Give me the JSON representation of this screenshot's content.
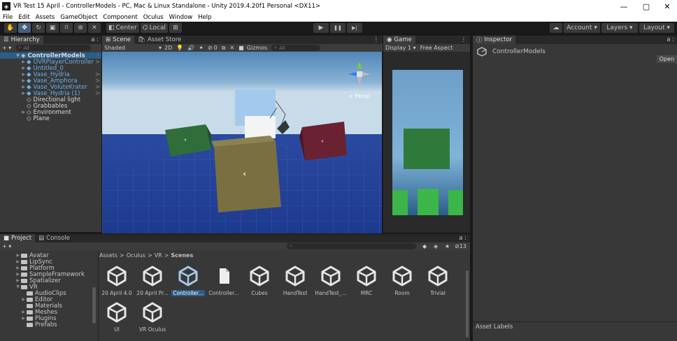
{
  "window": {
    "title": "VR Test 15 April - ControllerModels - PC, Mac & Linux Standalone - Unity 2019.4.20f1 Personal <DX11>",
    "logo": "◈",
    "minimize": "—",
    "maximize": "▢",
    "close": "✕"
  },
  "menu": [
    "File",
    "Edit",
    "Assets",
    "GameObject",
    "Component",
    "Oculus",
    "Window",
    "Help"
  ],
  "toolbar": {
    "tools": [
      "✋",
      "✥",
      "↻",
      "▣",
      "⌑",
      "⊛",
      "✕"
    ],
    "pivot": "Center",
    "space": "Local",
    "snap": "⊞",
    "play": "▶",
    "pause": "❚❚",
    "step": "▶|",
    "cloud": "☁",
    "account": "Account ▾",
    "layers": "Layers ▾",
    "layout": "Layout ▾"
  },
  "hierarchy": {
    "tab": "Hierarchy",
    "lock": "a :",
    "add": "+ ▾",
    "search_placeholder": "All",
    "items": [
      {
        "label": "ControllerModels",
        "kind": "scene",
        "sel": true,
        "more": "⋮"
      },
      {
        "label": "OVRPlayerController",
        "kind": "prefab",
        "more": ">"
      },
      {
        "label": "Untitled_0",
        "kind": "prefab",
        "more": ""
      },
      {
        "label": "Vase_Hydria",
        "kind": "prefab",
        "more": ">"
      },
      {
        "label": "Vase_Amphora",
        "kind": "prefab",
        "more": ">"
      },
      {
        "label": "Vase_VoluteKrater",
        "kind": "prefab",
        "more": ">"
      },
      {
        "label": "Vase_Hydria (1)",
        "kind": "prefab",
        "more": ">"
      },
      {
        "label": "Directional light",
        "kind": "object",
        "more": ""
      },
      {
        "label": "Grabbables",
        "kind": "object",
        "more": ""
      },
      {
        "label": "Environment",
        "kind": "object",
        "more": ""
      },
      {
        "label": "Plane",
        "kind": "object",
        "more": ""
      }
    ]
  },
  "scene": {
    "tabs": [
      "Scene",
      "Asset Store"
    ],
    "menu": "⋮",
    "shading": "Shaded",
    "mode2d": "2D",
    "effects_count": "0",
    "gizmos": "Gizmos",
    "search_placeholder": "All",
    "persp": "< Persp",
    "toolbar_icons": [
      "💡",
      "🔊",
      "✦",
      "⊘",
      "⧉",
      "✕",
      "■"
    ]
  },
  "game": {
    "tab": "Game",
    "menu": "⋮",
    "display": "Display 1 ▾",
    "aspect": "Free Aspect"
  },
  "inspector": {
    "tab": "Inspector",
    "lock": "a :",
    "object_name": "ControllerModels",
    "open_btn": "Open",
    "asset_labels": "Asset Labels"
  },
  "project": {
    "tabs": [
      "Project",
      "Console"
    ],
    "lock": "a :",
    "add": "+ ▾",
    "hidden_count": "13",
    "breadcrumb": [
      "Assets",
      "Oculus",
      "VR",
      "Scenes"
    ],
    "folders": [
      {
        "label": "Avatar",
        "indent": 1,
        "expanded": false
      },
      {
        "label": "LipSync",
        "indent": 1,
        "expanded": false
      },
      {
        "label": "Platform",
        "indent": 1,
        "expanded": false
      },
      {
        "label": "SampleFramework",
        "indent": 1,
        "expanded": false
      },
      {
        "label": "Spatializer",
        "indent": 1,
        "expanded": false
      },
      {
        "label": "VR",
        "indent": 1,
        "expanded": true
      },
      {
        "label": "AudioClips",
        "indent": 2,
        "expanded": null
      },
      {
        "label": "Editor",
        "indent": 2,
        "expanded": false
      },
      {
        "label": "Materials",
        "indent": 2,
        "expanded": null
      },
      {
        "label": "Meshes",
        "indent": 2,
        "expanded": false
      },
      {
        "label": "Plugins",
        "indent": 2,
        "expanded": false
      },
      {
        "label": "Prefabs",
        "indent": 2,
        "expanded": null
      }
    ],
    "assets": [
      {
        "label": "20 April 4.0",
        "kind": "scene"
      },
      {
        "label": "20 April Pr...",
        "kind": "scene"
      },
      {
        "label": "Controller...",
        "kind": "scene",
        "sel": true
      },
      {
        "label": "Controller...",
        "kind": "file"
      },
      {
        "label": "Cubes",
        "kind": "scene"
      },
      {
        "label": "HandTest",
        "kind": "scene"
      },
      {
        "label": "HandTest_...",
        "kind": "scene"
      },
      {
        "label": "MRC",
        "kind": "scene"
      },
      {
        "label": "Room",
        "kind": "scene"
      },
      {
        "label": "Trivial",
        "kind": "scene"
      },
      {
        "label": "UI",
        "kind": "scene"
      },
      {
        "label": "VR Oculus",
        "kind": "scene"
      }
    ]
  },
  "colors": {
    "accent": "#2c5d87",
    "panel": "#383838",
    "prefab_blue": "#6ab0e8"
  }
}
